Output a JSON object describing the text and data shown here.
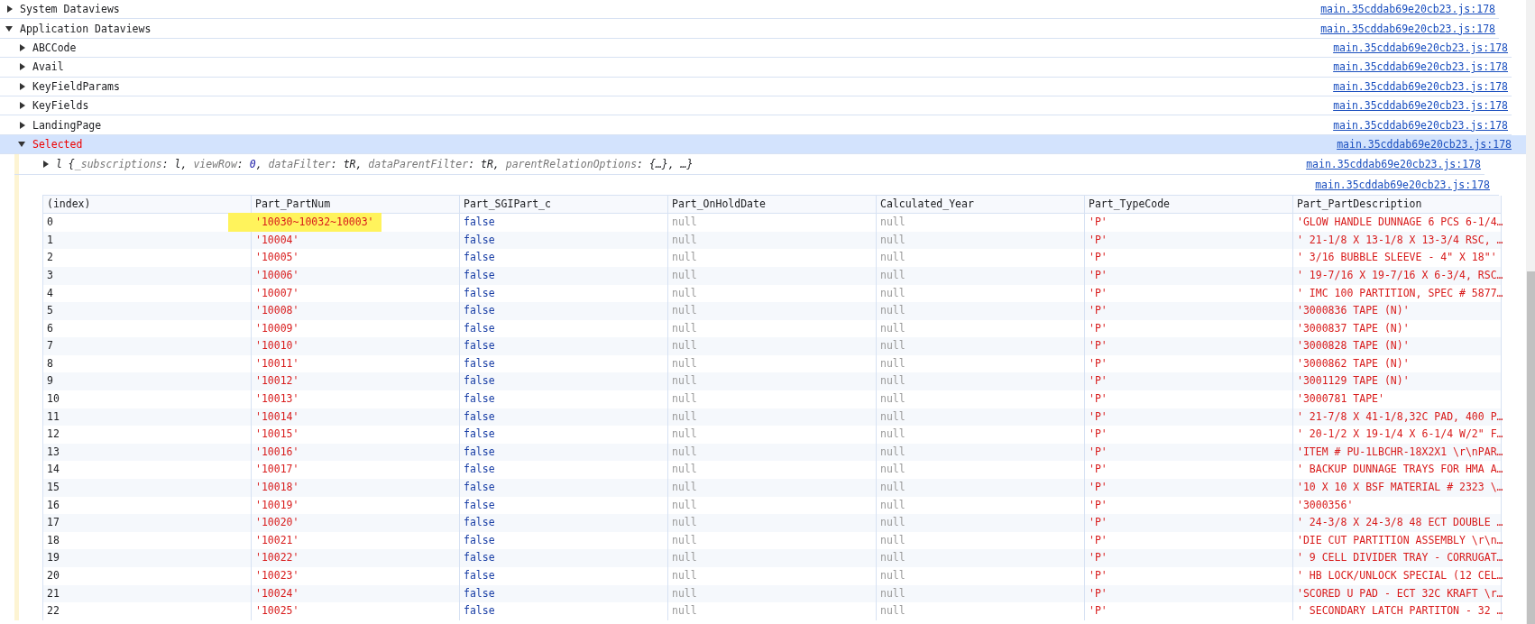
{
  "console": [
    {
      "label": "System Dataviews",
      "expanded": false,
      "selected": false,
      "source": "main.35cddab69e20cb23.js:178"
    },
    {
      "label": "Application Dataviews",
      "expanded": true,
      "selected": false,
      "source": "main.35cddab69e20cb23.js:178",
      "children": [
        {
          "label": "ABCCode",
          "expanded": false,
          "selected": false,
          "source": "main.35cddab69e20cb23.js:178"
        },
        {
          "label": "Avail",
          "expanded": false,
          "selected": false,
          "source": "main.35cddab69e20cb23.js:178"
        },
        {
          "label": "KeyFieldParams",
          "expanded": false,
          "selected": false,
          "source": "main.35cddab69e20cb23.js:178"
        },
        {
          "label": "KeyFields",
          "expanded": false,
          "selected": false,
          "source": "main.35cddab69e20cb23.js:178"
        },
        {
          "label": "LandingPage",
          "expanded": false,
          "selected": false,
          "source": "main.35cddab69e20cb23.js:178"
        },
        {
          "label": "Selected",
          "expanded": true,
          "selected": true,
          "source": "main.35cddab69e20cb23.js:178"
        }
      ]
    }
  ],
  "entries": [
    {
      "kind": "object",
      "expanded": false,
      "source": "main.35cddab69e20cb23.js:178",
      "parts": [
        {
          "kind": "name",
          "text": "l"
        },
        {
          "kind": "punct",
          "text": " {"
        },
        {
          "kind": "key",
          "text": "_subscriptions"
        },
        {
          "kind": "punct",
          "text": ": "
        },
        {
          "kind": "name",
          "text": "l"
        },
        {
          "kind": "punct",
          "text": ", "
        },
        {
          "kind": "key",
          "text": "viewRow"
        },
        {
          "kind": "punct",
          "text": ": "
        },
        {
          "kind": "number",
          "text": "0"
        },
        {
          "kind": "punct",
          "text": ", "
        },
        {
          "kind": "key",
          "text": "dataFilter"
        },
        {
          "kind": "punct",
          "text": ": "
        },
        {
          "kind": "name",
          "text": "tR"
        },
        {
          "kind": "punct",
          "text": ", "
        },
        {
          "kind": "key",
          "text": "dataParentFilter"
        },
        {
          "kind": "punct",
          "text": ": "
        },
        {
          "kind": "name",
          "text": "tR"
        },
        {
          "kind": "punct",
          "text": ", "
        },
        {
          "kind": "key",
          "text": "parentRelationOptions"
        },
        {
          "kind": "punct",
          "text": ": {…}, …}"
        }
      ]
    },
    {
      "kind": "table",
      "source": "main.35cddab69e20cb23.js:178",
      "columns": [
        {
          "label": "(index)",
          "kind": "index"
        },
        {
          "label": "Part_PartNum",
          "kind": "string"
        },
        {
          "label": "Part_SGIPart_c",
          "kind": "boolean"
        },
        {
          "label": "Part_OnHoldDate",
          "kind": "null"
        },
        {
          "label": "Calculated_Year",
          "kind": "null"
        },
        {
          "label": "Part_TypeCode",
          "kind": "string"
        },
        {
          "label": "Part_PartDescription",
          "kind": "string"
        }
      ],
      "rows": [
        {
          "highlighted": true,
          "cells": [
            "0",
            "'10030~10032~10003'",
            "false",
            "null",
            "null",
            "'P'",
            "'GLOW HANDLE DUNNAGE 6 PCS 6-1/4…"
          ]
        },
        {
          "highlighted": false,
          "cells": [
            "1",
            "'10004'",
            "false",
            "null",
            "null",
            "'P'",
            "' 21-1/8 X 13-1/8 X 13-3/4 RSC, …"
          ]
        },
        {
          "highlighted": false,
          "cells": [
            "2",
            "'10005'",
            "false",
            "null",
            "null",
            "'P'",
            "' 3/16 BUBBLE SLEEVE - 4\" X 18\"'"
          ]
        },
        {
          "highlighted": false,
          "cells": [
            "3",
            "'10006'",
            "false",
            "null",
            "null",
            "'P'",
            "' 19-7/16 X 19-7/16 X 6-3/4, RSC…"
          ]
        },
        {
          "highlighted": false,
          "cells": [
            "4",
            "'10007'",
            "false",
            "null",
            "null",
            "'P'",
            "' IMC 100 PARTITION, SPEC # 5877…"
          ]
        },
        {
          "highlighted": false,
          "cells": [
            "5",
            "'10008'",
            "false",
            "null",
            "null",
            "'P'",
            "'3000836 TAPE (N)'"
          ]
        },
        {
          "highlighted": false,
          "cells": [
            "6",
            "'10009'",
            "false",
            "null",
            "null",
            "'P'",
            "'3000837 TAPE (N)'"
          ]
        },
        {
          "highlighted": false,
          "cells": [
            "7",
            "'10010'",
            "false",
            "null",
            "null",
            "'P'",
            "'3000828 TAPE (N)'"
          ]
        },
        {
          "highlighted": false,
          "cells": [
            "8",
            "'10011'",
            "false",
            "null",
            "null",
            "'P'",
            "'3000862 TAPE (N)'"
          ]
        },
        {
          "highlighted": false,
          "cells": [
            "9",
            "'10012'",
            "false",
            "null",
            "null",
            "'P'",
            "'3001129 TAPE (N)'"
          ]
        },
        {
          "highlighted": false,
          "cells": [
            "10",
            "'10013'",
            "false",
            "null",
            "null",
            "'P'",
            "'3000781 TAPE'"
          ]
        },
        {
          "highlighted": false,
          "cells": [
            "11",
            "'10014'",
            "false",
            "null",
            "null",
            "'P'",
            "' 21-7/8 X 41-1/8,32C PAD, 400 P…"
          ]
        },
        {
          "highlighted": false,
          "cells": [
            "12",
            "'10015'",
            "false",
            "null",
            "null",
            "'P'",
            "' 20-1/2 X 19-1/4 X 6-1/4 W/2\" F…"
          ]
        },
        {
          "highlighted": false,
          "cells": [
            "13",
            "'10016'",
            "false",
            "null",
            "null",
            "'P'",
            "'ITEM # PU-1LBCHR-18X2X1 \\r\\nPAR…"
          ]
        },
        {
          "highlighted": false,
          "cells": [
            "14",
            "'10017'",
            "false",
            "null",
            "null",
            "'P'",
            "' BACKUP DUNNAGE TRAYS FOR HMA A…"
          ]
        },
        {
          "highlighted": false,
          "cells": [
            "15",
            "'10018'",
            "false",
            "null",
            "null",
            "'P'",
            "'10 X 10 X BSF MATERIAL # 2323 \\…"
          ]
        },
        {
          "highlighted": false,
          "cells": [
            "16",
            "'10019'",
            "false",
            "null",
            "null",
            "'P'",
            "'3000356'"
          ]
        },
        {
          "highlighted": false,
          "cells": [
            "17",
            "'10020'",
            "false",
            "null",
            "null",
            "'P'",
            "' 24-3/8 X 24-3/8 48 ECT DOUBLE …"
          ]
        },
        {
          "highlighted": false,
          "cells": [
            "18",
            "'10021'",
            "false",
            "null",
            "null",
            "'P'",
            "'DIE CUT PARTITION ASSEMBLY \\r\\n…"
          ]
        },
        {
          "highlighted": false,
          "cells": [
            "19",
            "'10022'",
            "false",
            "null",
            "null",
            "'P'",
            "' 9 CELL DIVIDER TRAY - CORRUGAT…"
          ]
        },
        {
          "highlighted": false,
          "cells": [
            "20",
            "'10023'",
            "false",
            "null",
            "null",
            "'P'",
            "' HB LOCK/UNLOCK SPECIAL (12 CEL…"
          ]
        },
        {
          "highlighted": false,
          "cells": [
            "21",
            "'10024'",
            "false",
            "null",
            "null",
            "'P'",
            "'SCORED U PAD - ECT 32C KRAFT \\r…"
          ]
        },
        {
          "highlighted": false,
          "cells": [
            "22",
            "'10025'",
            "false",
            "null",
            "null",
            "'P'",
            "' SECONDARY LATCH PARTITON - 32 …"
          ]
        }
      ]
    }
  ]
}
